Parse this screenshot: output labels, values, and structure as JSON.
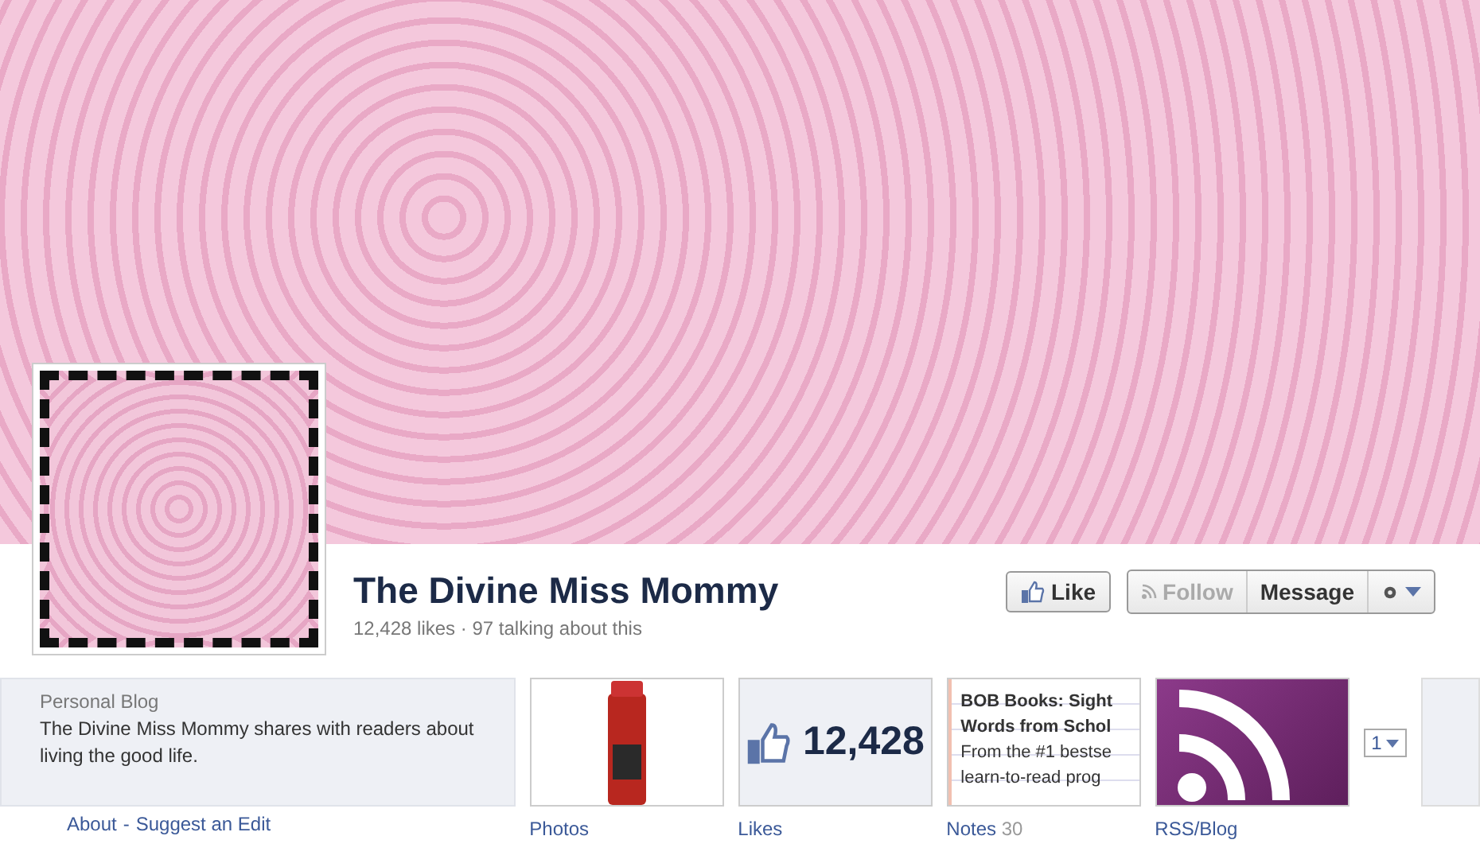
{
  "page": {
    "name": "The Divine Miss Mommy",
    "stats": "12,428 likes · 97 talking about this"
  },
  "actions": {
    "like": "Like",
    "follow": {
      "label": "Follow",
      "disabled": true
    },
    "message": "Message"
  },
  "about": {
    "category": "Personal Blog",
    "description": "The Divine Miss Mommy shares with readers about living the good life.",
    "links": [
      "About",
      "Suggest an Edit"
    ],
    "separator": "-"
  },
  "apps": [
    {
      "kind": "photo",
      "label": "Photos"
    },
    {
      "kind": "likes",
      "label": "Likes",
      "count": "12,428"
    },
    {
      "kind": "notes",
      "label": "Notes",
      "count": "30",
      "title_lines": [
        "BOB Books: Sight",
        "Words from Schol"
      ],
      "excerpt_lines": [
        "From the #1 bestse",
        "learn-to-read prog"
      ]
    },
    {
      "kind": "rss",
      "label": "RSS/Blog"
    }
  ],
  "more": {
    "count": "1"
  }
}
